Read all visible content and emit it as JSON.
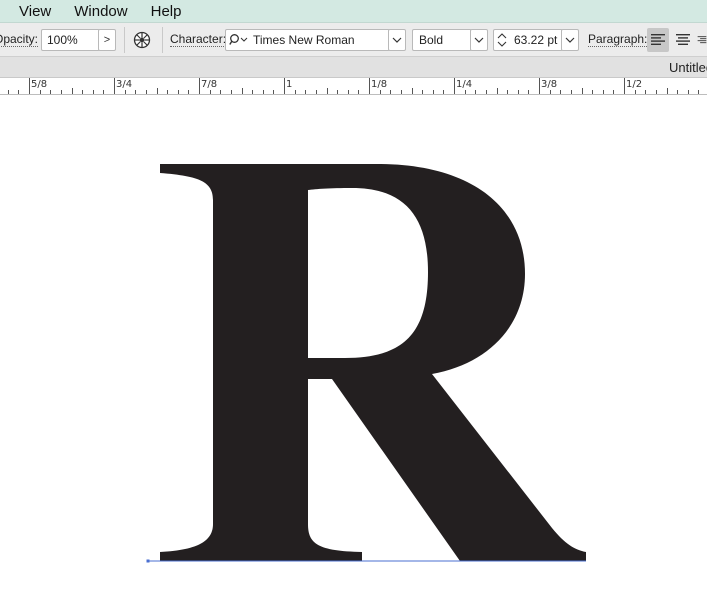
{
  "menubar": {
    "items": [
      "View",
      "Window",
      "Help"
    ]
  },
  "controlbar": {
    "opacity_label": "Opacity:",
    "opacity_value": "100%",
    "opacity_arrow": ">",
    "character_label": "Character:",
    "font_family": "Times New Roman",
    "font_style": "Bold",
    "font_size": "63.22 pt",
    "paragraph_label": "Paragraph:"
  },
  "document": {
    "title": "Untitled"
  },
  "ruler": {
    "labels": [
      "5/8",
      "3/4",
      "7/8",
      "1",
      "1/8",
      "1/4",
      "3/8",
      "1/2"
    ]
  },
  "canvas": {
    "glyph": "R"
  },
  "colors": {
    "menubar_bg": "#d3e9e2",
    "glyph_fill": "#231f20",
    "baseline": "#4a6fd1"
  },
  "icons": {
    "recolor": "recolor-artwork-icon",
    "font_search": "font-search-icon",
    "stepper": "stepper-icon",
    "align_left": "align-left-icon",
    "align_center": "align-center-icon"
  }
}
